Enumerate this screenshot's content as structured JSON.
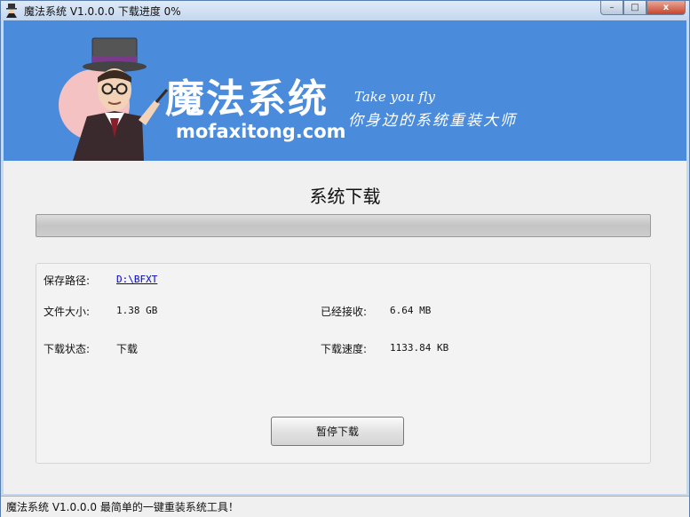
{
  "window": {
    "title": "魔法系统 V1.0.0.0 下载进度 0%",
    "controls": {
      "minimize": "–",
      "maximize": "□",
      "close": "x"
    }
  },
  "banner": {
    "logo_text": "魔法系统",
    "url": "mofaxitong.com",
    "tagline_en": "Take you fly",
    "tagline_cn": "你身边的系统重装大师"
  },
  "download": {
    "title": "系统下载",
    "progress_percent": 0
  },
  "info": {
    "save_path_label": "保存路径:",
    "save_path": "D:\\BFXT",
    "file_size_label": "文件大小:",
    "file_size": "1.38 GB",
    "received_label": "已经接收:",
    "received": "6.64 MB",
    "status_label": "下载状态:",
    "status": "下载",
    "speed_label": "下载速度:",
    "speed": "1133.84 KB"
  },
  "buttons": {
    "pause": "暂停下载"
  },
  "statusbar": {
    "text": "魔法系统 V1.0.0.0 最简单的一键重装系统工具！"
  },
  "colors": {
    "banner": "#4a8bdc",
    "window_frame": "#c5d9f0",
    "link": "#0000cc"
  }
}
